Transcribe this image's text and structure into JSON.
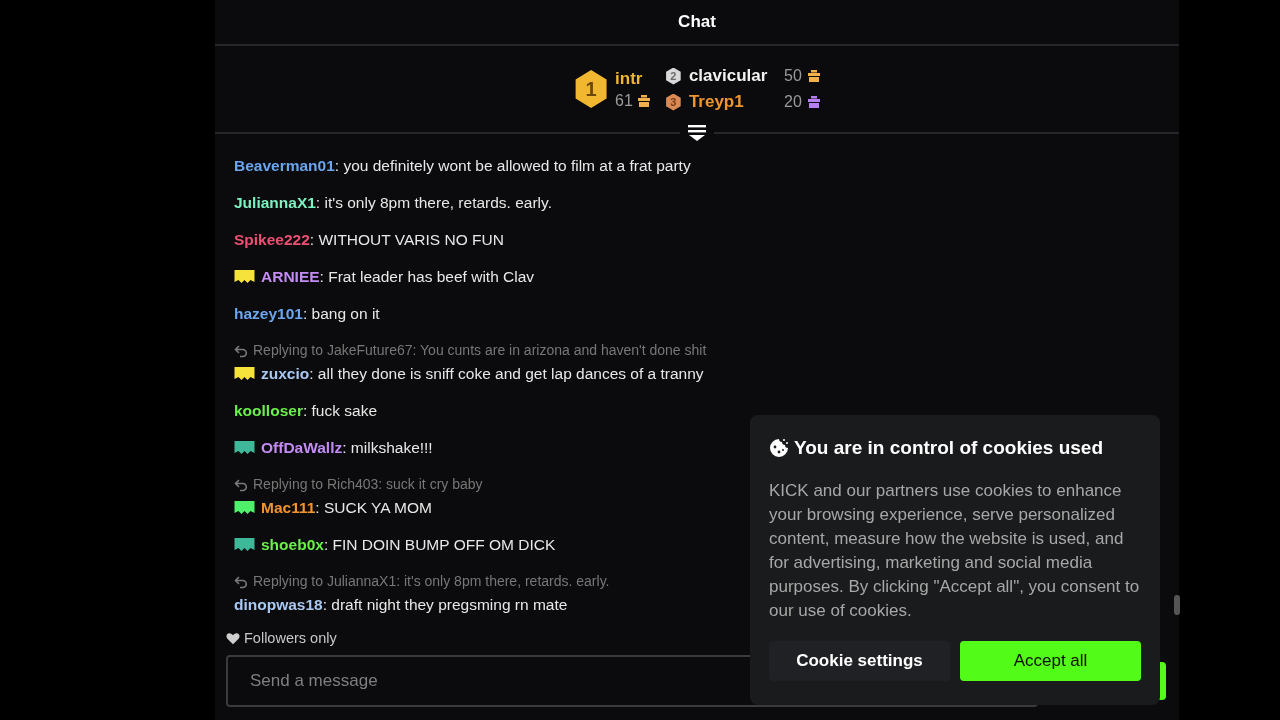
{
  "chat": {
    "title": "Chat"
  },
  "leaderboard": [
    {
      "rank": "1",
      "name": "intr",
      "count": "61",
      "color": "#f2b731",
      "gift": {
        "color": "#f2b04a"
      }
    },
    {
      "rank": "2",
      "name": "clavicular",
      "count": "50",
      "color": "#f2f2f2",
      "gift": {
        "color": "#f2b04a"
      }
    },
    {
      "rank": "3",
      "name": "Treyp1",
      "count": "20",
      "color": "#f0952e",
      "gift": {
        "color": "#b57ff0"
      }
    }
  ],
  "messages": [
    {
      "user": "Beaverman01",
      "color": "#6ba6f0",
      "text": ": you definitely wont be allowed to film at a frat party"
    },
    {
      "user": "JuliannaX1",
      "color": "#7cf2c0",
      "text": ": it's only 8pm there, retards. early."
    },
    {
      "user": "Spikee222",
      "color": "#ef4f72",
      "text": ": WITHOUT VARIS NO FUN"
    },
    {
      "user": "ARNIEE",
      "color": "#c38cf5",
      "badge": {
        "color": "#f5e23a"
      },
      "text": ": Frat leader has beef with Clav"
    },
    {
      "user": "hazey101",
      "color": "#6ba6f0",
      "text": ": bang on it"
    },
    {
      "reply": "Replying to JakeFuture67: You cunts are in arizona and haven't done shit",
      "user": "zuxcio",
      "color": "#a9c8f2",
      "badge": {
        "color": "#f5e23a"
      },
      "text": ": all they done is sniff coke and get lap dances of a tranny"
    },
    {
      "user": "koolloser",
      "color": "#6af04a",
      "text": ": fuck sake"
    },
    {
      "user": "OffDaWallz",
      "color": "#c38cf5",
      "badge": {
        "color": "#3fb89a"
      },
      "text": ": milkshake!!!"
    },
    {
      "reply": "Replying to Rich403: suck it cry baby",
      "user": "Mac111",
      "color": "#f0952e",
      "badge": {
        "color": "#4ff06a"
      },
      "text": ": SUCK YA MOM"
    },
    {
      "user": "shoeb0x",
      "color": "#6af04a",
      "badge": {
        "color": "#3fb89a"
      },
      "text": ": FIN DOIN BUMP OFF OM DICK"
    },
    {
      "reply": "Replying to JuliannaX1: it's only 8pm there, retards. early.",
      "user": "dinopwas18",
      "color": "#a9c8f2",
      "text": ": draft night they pregsming rn mate"
    }
  ],
  "chat_mode": "Followers only",
  "message_field": {
    "placeholder": "Send a message"
  },
  "cookie_banner": {
    "title": "You are in control of cookies used",
    "body": "KICK and our partners use cookies to enhance your browsing experience, serve personalized content, measure how the website is used, and for advertising, marketing and social media purposes. By clicking \"Accept all\", you consent to our use of cookies.",
    "buttons": [
      {
        "label": "Cookie settings",
        "kind": "secondary"
      },
      {
        "label": "Accept all",
        "kind": "primary"
      }
    ]
  }
}
